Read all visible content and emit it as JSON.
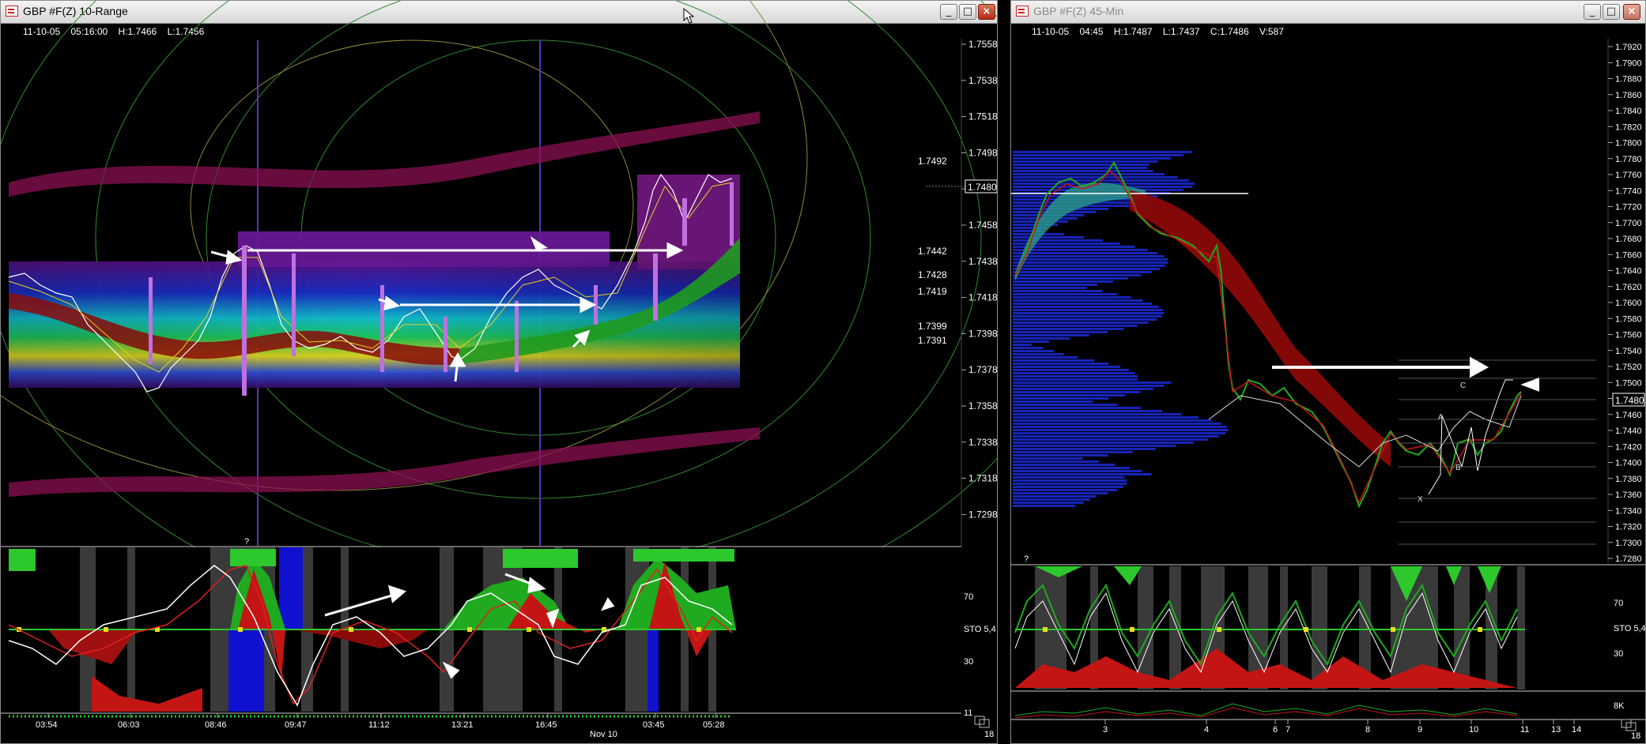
{
  "left_window": {
    "title": "GBP #F(Z) 10-Range",
    "info": "11-10-05    05:16:00    H:1.7466    L:1.7456",
    "price_axis": [
      "1.7558",
      "1.7538",
      "1.7518",
      "1.7498",
      "1.7478",
      "1.7458",
      "1.7438",
      "1.7418",
      "1.7398",
      "1.7378",
      "1.7358",
      "1.7338",
      "1.7318",
      "1.7298"
    ],
    "current_price": "1.7480",
    "levels": [
      "1.7492",
      "1.7442",
      "1.7428",
      "1.7419",
      "1.7399",
      "1.7391"
    ],
    "osc_labels": {
      "upper": "70",
      "mid": "STO 5,4",
      "lower": "30",
      "bottom": "11"
    },
    "time_axis": [
      "03:54",
      "06:03",
      "08:46",
      "09:47",
      "11:12",
      "13:21",
      "16:45",
      "03:45",
      "05:28"
    ],
    "date_label": "Nov 10",
    "question_marker": "?",
    "corner": "18"
  },
  "right_window": {
    "title": "GBP #F(Z) 45-Min",
    "info": "11-10-05    04:45    H:1.7487    L:1.7437    C:1.7486    V:587",
    "price_axis": [
      "1.7920",
      "1.7900",
      "1.7880",
      "1.7860",
      "1.7840",
      "1.7820",
      "1.7800",
      "1.7780",
      "1.7760",
      "1.7740",
      "1.7720",
      "1.7700",
      "1.7680",
      "1.7660",
      "1.7640",
      "1.7620",
      "1.7600",
      "1.7580",
      "1.7560",
      "1.7540",
      "1.7520",
      "1.7500",
      "1.7480",
      "1.7460",
      "1.7440",
      "1.7420",
      "1.7400",
      "1.7380",
      "1.7360",
      "1.7340",
      "1.7320",
      "1.7300",
      "1.7280"
    ],
    "current_price": "1.7480",
    "pattern_labels": {
      "x": "X",
      "a": "A",
      "b": "B",
      "c": "C"
    },
    "osc_labels": {
      "upper": "70",
      "mid": "STO 5,4",
      "lower": "30"
    },
    "volume_label": "8K",
    "date_axis": [
      "3",
      "4",
      "6",
      "7",
      "8",
      "9",
      "10",
      "11",
      "13",
      "14"
    ],
    "question_marker": "?",
    "corner": "18"
  },
  "colors": {
    "background": "#000000",
    "green": "#19b219",
    "red": "#c41515",
    "violet": "#9a2bd6",
    "arrow": "#ffffff"
  }
}
